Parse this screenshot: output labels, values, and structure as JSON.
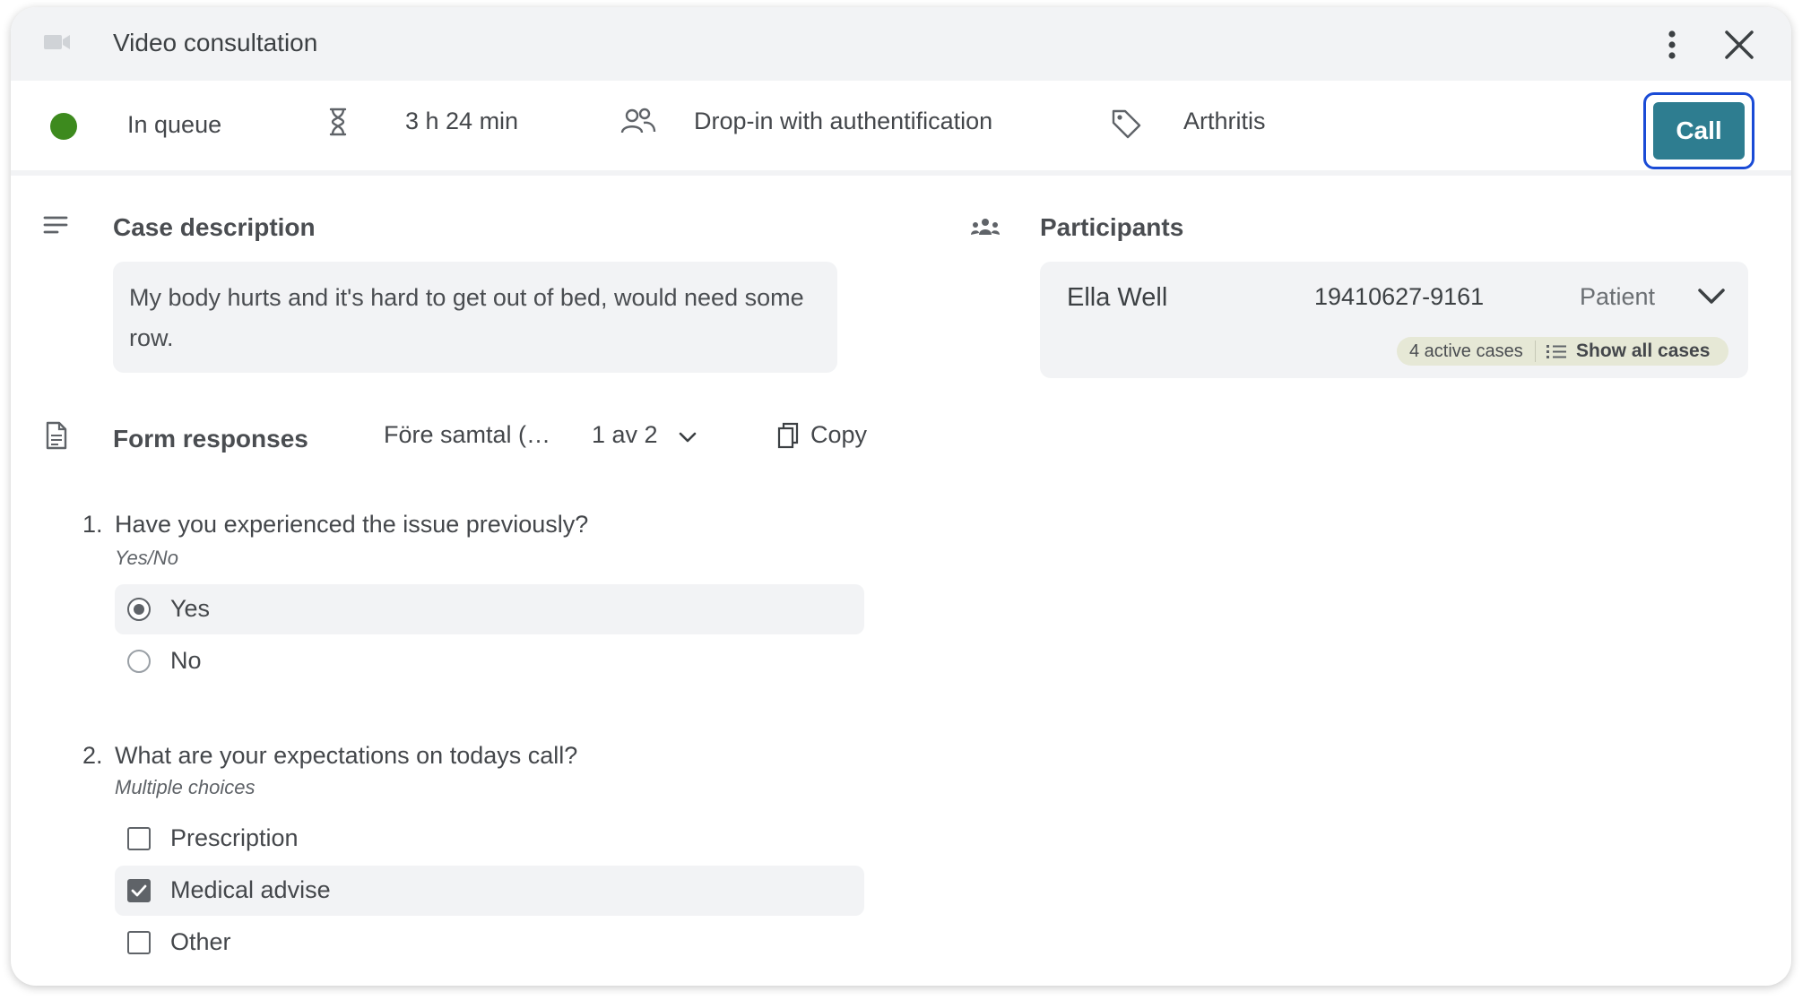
{
  "header": {
    "title": "Video consultation",
    "icons": {
      "camera": "video-camera-icon",
      "more": "more-vertical-icon",
      "close": "close-icon"
    }
  },
  "info_bar": {
    "status": "In queue",
    "status_color": "#3d8a1e",
    "wait_time": "3 h 24 min",
    "queue_type": "Drop-in with authentification",
    "tag": "Arthritis",
    "call_label": "Call",
    "call_color": "#2e7d90"
  },
  "case": {
    "title": "Case description",
    "text": "My body hurts and it's hard to get out of bed, would need some row."
  },
  "participants": {
    "title": "Participants",
    "items": [
      {
        "name": "Ella Well",
        "id": "19410627-9161",
        "role": "Patient",
        "active_cases": "4 active cases",
        "show_all": "Show all cases"
      }
    ]
  },
  "form": {
    "title": "Form responses",
    "form_name": "Före  samtal (…",
    "pager": "1 av 2",
    "copy_label": "Copy",
    "questions": [
      {
        "number": "1.",
        "text": "Have you experienced the issue previously?",
        "hint": "Yes/No",
        "options": [
          {
            "label": "Yes",
            "selected": true
          },
          {
            "label": "No",
            "selected": false
          }
        ]
      },
      {
        "number": "2.",
        "text": "What are your expectations on todays call?",
        "hint": "Multiple choices",
        "options": [
          {
            "label": "Prescription",
            "selected": false
          },
          {
            "label": "Medical advise",
            "selected": true
          },
          {
            "label": "Other",
            "selected": false
          }
        ]
      }
    ]
  }
}
